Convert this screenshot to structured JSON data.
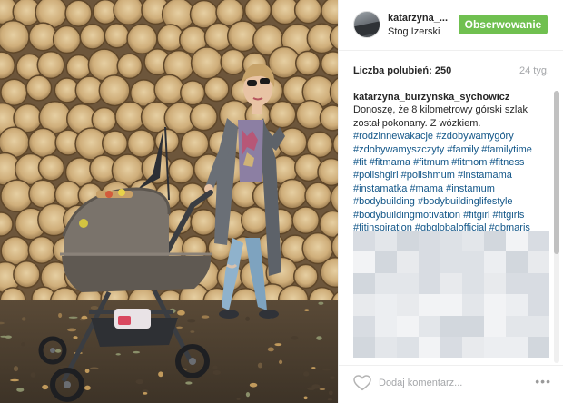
{
  "post": {
    "username": "katarzyna_...",
    "location": "Stog Izerski",
    "follow_label": "Obserwowanie",
    "likes_label": "Liczba polubień: 250",
    "age": "24 tyg.",
    "caption": {
      "user": "katarzyna_burzynska_sychowicz",
      "text": " Donoszę, że 8 kilometrowy górski szlak został pokonany. Z wózkiem.",
      "hashtags": [
        "#rodzinnewakacje",
        "#zdobywamygóry",
        "#zdobywamyszczyty",
        "#family",
        "#familytime",
        "#fit",
        "#fitmama",
        "#fitmum",
        "#fitmom",
        "#fitness",
        "#polishgirl",
        "#polishmum",
        "#instamama",
        "#instamatka",
        "#mama",
        "#instamum",
        "#bodybuilding",
        "#bodybuildinglifestyle",
        "#bodybuildingmotivation",
        "#fitgirl",
        "#fitgirls",
        "#fitinspiration",
        "#gbglobalofficial",
        "#gbmaris"
      ]
    },
    "comment_placeholder": "Dodaj komentarz...",
    "more_label": "•••"
  },
  "colors": {
    "follow_button": "#70c050",
    "hashtag": "#125688",
    "muted": "#a5a7aa"
  },
  "icons": {
    "like": "heart-outline-icon",
    "more": "more-options-icon"
  }
}
